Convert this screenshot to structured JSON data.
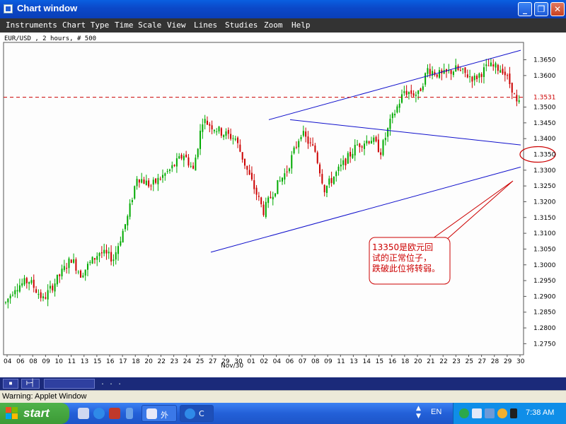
{
  "window": {
    "title": "Chart window",
    "min_label": "_",
    "max_label": "❐",
    "close_label": "✕"
  },
  "menu": [
    {
      "label": "Instruments"
    },
    {
      "label": "Chart Type"
    },
    {
      "label": "Time Scale"
    },
    {
      "label": "View"
    },
    {
      "label": "Lines"
    },
    {
      "label": "Studies"
    },
    {
      "label": "Zoom"
    },
    {
      "label": "Help"
    }
  ],
  "chart": {
    "header": "EUR/USD , 2 hours, # 500",
    "current_price": "1.3531",
    "circled_level": "1.3350",
    "annotation": "13350是欧元回试的正常位子，跌破此位将转弱。",
    "month_label": "Nov/30",
    "colors": {
      "up": "#00aa00",
      "down": "#cc0000",
      "trend": "#1010cc",
      "price_line": "#cc0000"
    }
  },
  "chart_data": {
    "type": "candlestick",
    "instrument": "EUR/USD",
    "timeframe": "2 hours",
    "bars": 500,
    "y_ticks": [
      "1.3650",
      "1.3600",
      "1.3500",
      "1.3450",
      "1.3400",
      "1.3300",
      "1.3250",
      "1.3200",
      "1.3150",
      "1.3100",
      "1.3050",
      "1.3000",
      "1.2950",
      "1.2900",
      "1.2850",
      "1.2800",
      "1.2750"
    ],
    "x_ticks": [
      "04",
      "06",
      "08",
      "09",
      "10",
      "11",
      "13",
      "15",
      "16",
      "17",
      "18",
      "20",
      "22",
      "23",
      "24",
      "25",
      "27",
      "29",
      "30",
      "01",
      "02",
      "04",
      "06",
      "07",
      "08",
      "09",
      "11",
      "13",
      "14",
      "15",
      "16",
      "18",
      "20",
      "21",
      "22",
      "23",
      "25",
      "27",
      "28",
      "29",
      "30"
    ],
    "ylim": [
      1.2715,
      1.3705
    ],
    "price_path": [
      [
        0,
        1.288
      ],
      [
        4,
        1.293
      ],
      [
        10,
        1.295
      ],
      [
        16,
        1.289
      ],
      [
        22,
        1.2955
      ],
      [
        28,
        1.302
      ],
      [
        32,
        1.297
      ],
      [
        40,
        1.304
      ],
      [
        46,
        1.302
      ],
      [
        52,
        1.315
      ],
      [
        56,
        1.328
      ],
      [
        62,
        1.325
      ],
      [
        70,
        1.33
      ],
      [
        76,
        1.335
      ],
      [
        80,
        1.33
      ],
      [
        84,
        1.346
      ],
      [
        92,
        1.342
      ],
      [
        98,
        1.34
      ],
      [
        104,
        1.328
      ],
      [
        110,
        1.317
      ],
      [
        114,
        1.323
      ],
      [
        120,
        1.33
      ],
      [
        126,
        1.342
      ],
      [
        132,
        1.336
      ],
      [
        136,
        1.324
      ],
      [
        142,
        1.33
      ],
      [
        150,
        1.338
      ],
      [
        156,
        1.34
      ],
      [
        160,
        1.336
      ],
      [
        164,
        1.345
      ],
      [
        170,
        1.355
      ],
      [
        176,
        1.354
      ],
      [
        180,
        1.362
      ],
      [
        186,
        1.36
      ],
      [
        192,
        1.362
      ],
      [
        200,
        1.359
      ],
      [
        206,
        1.363
      ],
      [
        212,
        1.362
      ],
      [
        216,
        1.356
      ],
      [
        218,
        1.351
      ]
    ],
    "trendlines": [
      {
        "from": [
          0,
          1.346
        ],
        "to": [
          1,
          1.368
        ]
      },
      {
        "from": [
          0,
          1.346
        ],
        "to": [
          1,
          1.338
        ]
      },
      {
        "from": [
          0,
          1.304
        ],
        "to": [
          1,
          1.331
        ]
      }
    ]
  },
  "scrollbar": {
    "btn1": "▪",
    "btn2": "⊢┤",
    "text": ". . ."
  },
  "status": {
    "text": "Warning: Applet Window"
  },
  "taskbar": {
    "start_label": "start",
    "tasks": [
      {
        "label": "外"
      },
      {
        "label": "C"
      }
    ],
    "lang": "EN",
    "clock": "7:38 AM",
    "tray_up": "▲",
    "tray_down": "▼"
  }
}
